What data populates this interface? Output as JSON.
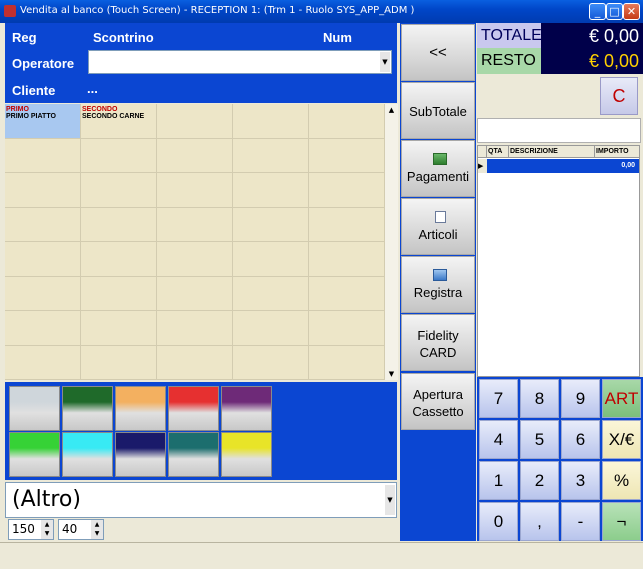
{
  "window": {
    "title": "Vendita al banco (Touch Screen) - RECEPTION 1: (Trm  1 - Ruolo SYS_APP_ADM )"
  },
  "header": {
    "reg_label": "Reg",
    "scontrino_label": "Scontrino",
    "num_label": "Num",
    "operatore_label": "Operatore",
    "cliente_label": "Cliente",
    "cliente_value": "..."
  },
  "products": [
    {
      "category": "PRIMO",
      "name": "PRIMO PIATTO"
    },
    {
      "category": "SECONDO",
      "name": "SECONDO CARNE"
    }
  ],
  "swatch_colors": [
    [
      "#cfd6db",
      "#1f6a2a",
      "#f3b060",
      "#e63030",
      "#6e2a78"
    ],
    [
      "#36d236",
      "#38eaf4",
      "#1a1a6a",
      "#1c6e6e",
      "#e8e428"
    ]
  ],
  "filter": {
    "selected": "(Altro)",
    "width_value": "150",
    "height_value": "40"
  },
  "actions": {
    "back": "<<",
    "subtotale": "SubTotale",
    "pagamenti": "Pagamenti",
    "articoli": "Articoli",
    "registra": "Registra",
    "fidelity_line1": "Fidelity",
    "fidelity_line2": "CARD",
    "apertura_line1": "Apertura",
    "apertura_line2": "Cassetto"
  },
  "totals": {
    "totale_label": "TOTALE",
    "totale_value": "€ 0,00",
    "resto_label": "RESTO",
    "resto_value": "€ 0,00",
    "clear_label": "C"
  },
  "receipt": {
    "columns": [
      "QTA",
      "DESCRIZIONE",
      "IMPORTO"
    ],
    "rows": [
      {
        "qta": "",
        "descrizione": "",
        "importo": "0,00"
      }
    ]
  },
  "keypad": {
    "rows": [
      [
        "7",
        "8",
        "9",
        "ART"
      ],
      [
        "4",
        "5",
        "6",
        "X/€"
      ],
      [
        "1",
        "2",
        "3",
        "%"
      ],
      [
        "0",
        ",",
        "-",
        "¬"
      ]
    ]
  },
  "colors": {
    "panel_blue": "#0b46d2",
    "totale_bg": "#00004a",
    "resto_bg": "#a8d8a8",
    "totale_label_bg": "#c9c8ee"
  }
}
